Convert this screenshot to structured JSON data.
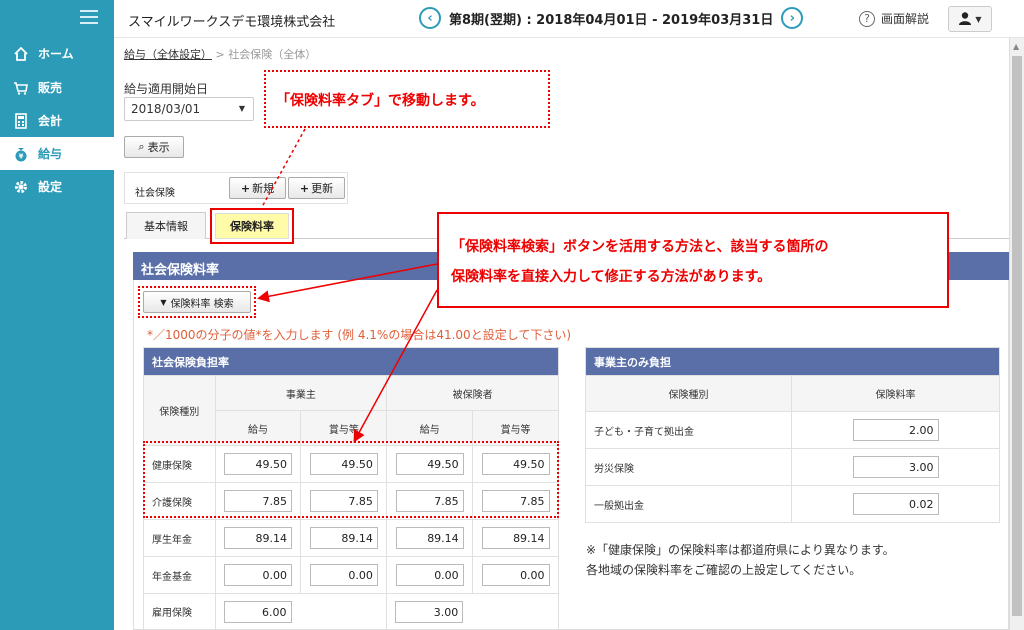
{
  "header": {
    "company": "スマイルワークスデモ環境株式会社",
    "period": "第8期(翌期) : 2018年04月01日 - 2019年03月31日",
    "help_label": "画面解説"
  },
  "sidebar": {
    "items": [
      {
        "label": "ホーム",
        "icon": "home-icon"
      },
      {
        "label": "販売",
        "icon": "cart-icon"
      },
      {
        "label": "会計",
        "icon": "calculator-icon"
      },
      {
        "label": "給与",
        "icon": "money-bag-icon"
      },
      {
        "label": "設定",
        "icon": "gear-icon"
      }
    ],
    "active_index": 3
  },
  "breadcrumb": {
    "link": "給与（全体設定）",
    "sep": ">",
    "current": "社会保険（全体）"
  },
  "form": {
    "start_label": "給与適用開始日",
    "start_value": "2018/03/01",
    "show_button": "表示",
    "show_icon": "⌕"
  },
  "social_box": {
    "label": "社会保険",
    "new_button": "新規",
    "update_button": "更新"
  },
  "tabs": {
    "basic": "基本情報",
    "rate": "保険料率"
  },
  "panel": {
    "title": "社会保険料率",
    "search_button": "保険料率 検索",
    "note": "*／1000の分子の値*を入力します (例 4.1%の場合は41.00と設定して下さい)"
  },
  "burden_table": {
    "title": "社会保険負担率",
    "type_header": "保険種別",
    "employer": "事業主",
    "insured": "被保険者",
    "salary": "給与",
    "bonus": "賞与等",
    "rows": [
      {
        "label": "健康保険",
        "values": [
          "49.50",
          "49.50",
          "49.50",
          "49.50"
        ]
      },
      {
        "label": "介護保険",
        "values": [
          "7.85",
          "7.85",
          "7.85",
          "7.85"
        ]
      },
      {
        "label": "厚生年金",
        "values": [
          "89.14",
          "89.14",
          "89.14",
          "89.14"
        ]
      },
      {
        "label": "年金基金",
        "values": [
          "0.00",
          "0.00",
          "0.00",
          "0.00"
        ]
      },
      {
        "label": "雇用保険",
        "values": [
          "6.00",
          "",
          "3.00",
          ""
        ]
      }
    ]
  },
  "employer_table": {
    "title": "事業主のみ負担",
    "type_header": "保険種別",
    "rate_header": "保険料率",
    "rows": [
      {
        "label": "子ども・子育て拠出金",
        "value": "2.00"
      },
      {
        "label": "労災保険",
        "value": "3.00"
      },
      {
        "label": "一般拠出金",
        "value": "0.02"
      }
    ]
  },
  "bottom_note": {
    "line1": "※「健康保険」の保険料率は都道府県により異なります。",
    "line2": "各地域の保険料率をご確認の上設定してください。"
  },
  "annotations": {
    "callout1": "「保険料率タブ」で移動します。",
    "callout2_line1": "「保険料率検索」ボタンを活用する方法と、該当する箇所の",
    "callout2_line2": "保険料率を直接入力して修正する方法があります。"
  },
  "colors": {
    "sidebar": "#2b9bb8",
    "table_header": "#5a6fa8",
    "annotation": "#e00000",
    "tab_highlight": "#fffba8"
  }
}
